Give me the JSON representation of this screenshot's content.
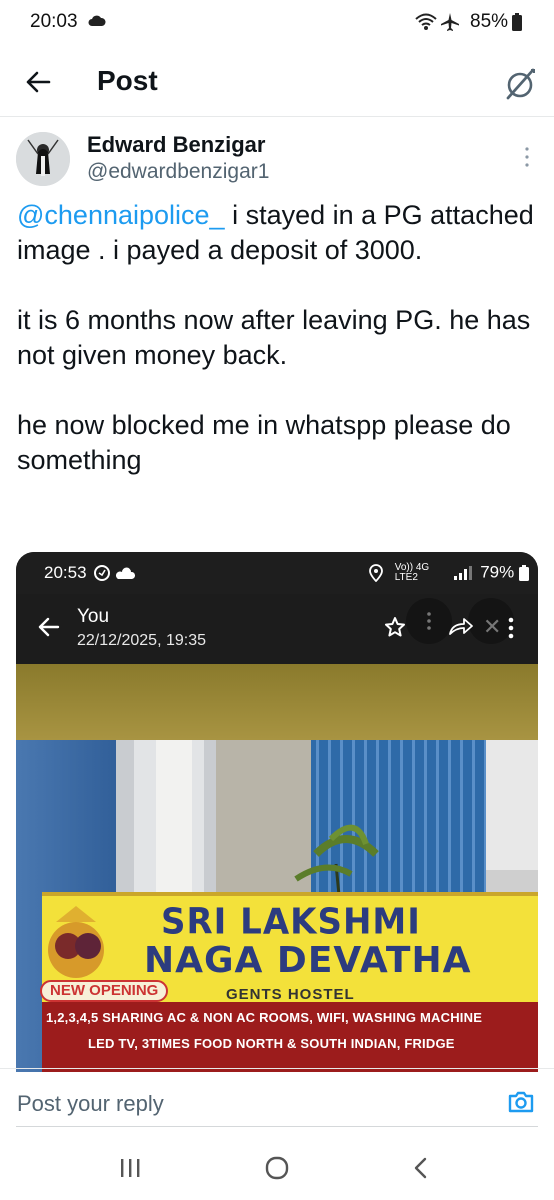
{
  "status_bar": {
    "time": "20:03",
    "battery": "85%",
    "icons": [
      "cloud-icon",
      "wifi-icon",
      "airplane-icon",
      "battery-icon"
    ]
  },
  "header": {
    "title": "Post",
    "back_icon": "arrow-left-icon",
    "grok_icon": "grok-icon"
  },
  "post": {
    "author_name": "Edward Benzigar",
    "author_handle": "@edwardbenzigar1",
    "text": {
      "mention": "@chennaipolice_",
      "line1_rest": " i stayed in a PG attached image . i payed a deposit of 3000.",
      "paragraph2": "it is 6 months now after leaving PG. he has not given money back.",
      "paragraph3": "he now blocked me in whatspp please do something"
    }
  },
  "media": {
    "status_time": "20:53",
    "status_network": "Vo)) 4G LTE2",
    "status_battery": "79%",
    "chat_contact": "You",
    "chat_timestamp": "22/12/2025, 19:35",
    "sign": {
      "line1": "SRI LAKSHMI",
      "line2": "NAGA DEVATHA",
      "badge": "NEW OPENING",
      "subtitle": "GENTS HOSTEL",
      "amenities1": "1,2,3,4,5 SHARING AC & NON AC ROOMS, WIFI, WASHING MACHINE",
      "amenities2": "LED TV, 3TIMES FOOD NORTH & SOUTH INDIAN, FRIDGE"
    },
    "colors": {
      "sign_yellow": "#f3e13a",
      "sign_red": "#9c1c1c",
      "sign_text_blue": "#2c3c7f",
      "wall_blue": "#2e6aa8"
    }
  },
  "reply": {
    "placeholder": "Post your reply",
    "camera_icon": "camera-icon"
  },
  "nav_bar": {
    "icons": [
      "recents-icon",
      "home-icon",
      "back-icon"
    ]
  },
  "colors": {
    "accent": "#1d9bf0",
    "text_primary": "#0f1419",
    "text_secondary": "#536471"
  }
}
